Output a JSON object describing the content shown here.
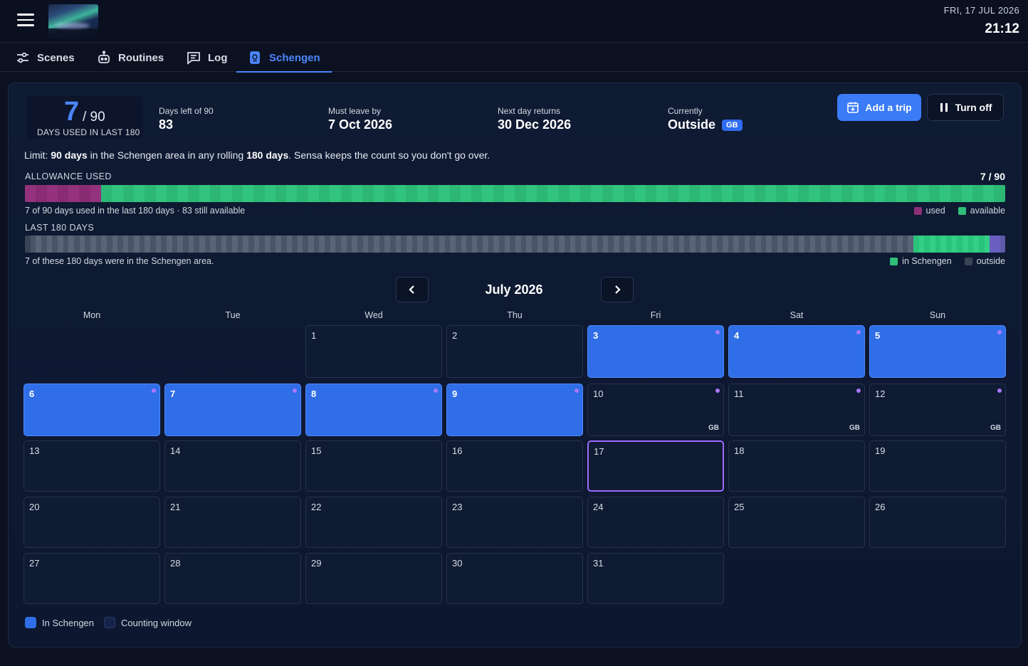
{
  "header": {
    "date": "FRI, 17 JUL 2026",
    "time": "21:12"
  },
  "tabs": [
    {
      "label": "Scenes",
      "icon": "sliders-icon"
    },
    {
      "label": "Routines",
      "icon": "robot-icon"
    },
    {
      "label": "Log",
      "icon": "message-icon"
    },
    {
      "label": "Schengen",
      "icon": "passport-icon",
      "active": true
    }
  ],
  "summary": {
    "days_used": "7",
    "days_total": "/ 90",
    "days_used_label": "DAYS USED IN LAST 180",
    "days_left_label": "Days left of 90",
    "days_left": "83",
    "must_leave_label": "Must leave by",
    "must_leave": "7 Oct 2026",
    "next_return_label": "Next day returns",
    "next_return": "30 Dec 2026",
    "currently_label": "Currently",
    "currently": "Outside",
    "country_badge": "GB"
  },
  "actions": {
    "add_trip": "Add a trip",
    "turn_off": "Turn off"
  },
  "limit_text": {
    "pre": "Limit: ",
    "b1": "90 days",
    "mid": " in the Schengen area in any rolling ",
    "b2": "180 days",
    "post": ". Sensa keeps the count so you don't go over."
  },
  "allowance": {
    "label": "ALLOWANCE USED",
    "value": "7 / 90",
    "used": 7,
    "total": 90,
    "caption": "7 of 90 days used in the last 180 days · 83 still available",
    "legend_used": "used",
    "legend_available": "available"
  },
  "last180": {
    "label": "LAST 180 DAYS",
    "in_schengen_days": 7,
    "caption": "7 of these 180 days were in the Schengen area.",
    "legend_in": "in Schengen",
    "legend_out": "outside"
  },
  "calendar": {
    "month_label": "July 2026",
    "weekdays": [
      "Mon",
      "Tue",
      "Wed",
      "Thu",
      "Fri",
      "Sat",
      "Sun"
    ],
    "first_weekday_index": 2,
    "days_in_month": 31,
    "in_schengen_days": [
      3,
      4,
      5,
      6,
      7,
      8,
      9
    ],
    "dot_days": [
      3,
      4,
      5,
      6,
      7,
      8,
      9,
      10,
      11,
      12
    ],
    "country_days": {
      "10": "GB",
      "11": "GB",
      "12": "GB"
    },
    "today": 17
  },
  "legend": {
    "in_schengen": "In Schengen",
    "counting_window": "Counting window"
  },
  "colors": {
    "accent": "#3b7bf6",
    "used": "#8e2f78",
    "available": "#2fbf7a",
    "today_border": "#9a6bff"
  }
}
